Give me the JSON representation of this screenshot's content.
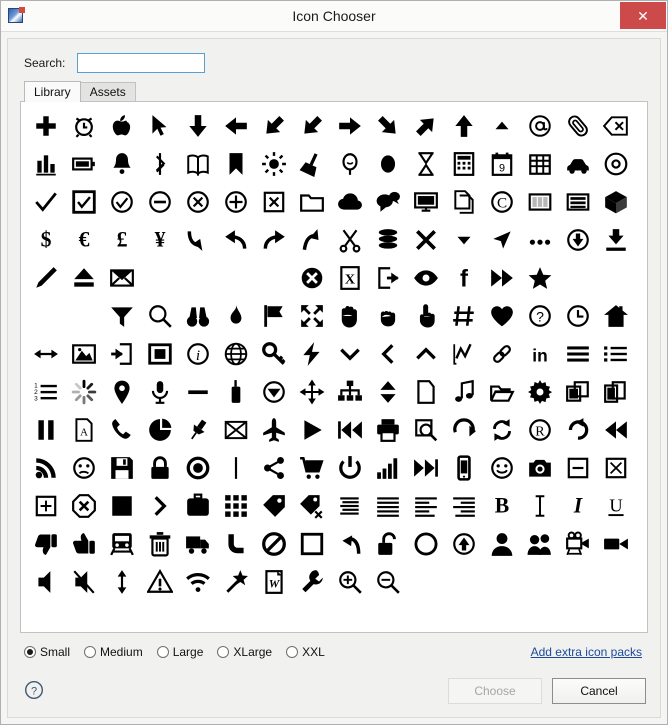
{
  "window": {
    "title": "Icon Chooser",
    "app_icon": "app-icon",
    "close_label": "✕"
  },
  "search": {
    "label": "Search:",
    "value": "",
    "placeholder": ""
  },
  "tabs": [
    {
      "label": "Library",
      "selected": true
    },
    {
      "label": "Assets",
      "selected": false
    }
  ],
  "sizes": {
    "options": [
      {
        "label": "Small",
        "checked": true
      },
      {
        "label": "Medium",
        "checked": false
      },
      {
        "label": "Large",
        "checked": false
      },
      {
        "label": "XLarge",
        "checked": false
      },
      {
        "label": "XXL",
        "checked": false
      }
    ]
  },
  "links": {
    "extra_packs": "Add extra icon packs"
  },
  "footer": {
    "help_icon": "question-mark-circle-icon",
    "choose_label": "Choose",
    "choose_enabled": false,
    "cancel_label": "Cancel",
    "cancel_enabled": true
  },
  "colors": {
    "close_button": "#cc4a4a",
    "link": "#1b4a9b",
    "search_border": "#5a9fd4",
    "window_bg": "#f1f1ef",
    "grid_bg": "#ffffff",
    "icon": "#000000"
  },
  "icon_grid": {
    "columns": 16,
    "rows": 13,
    "count": 202,
    "icons": [
      "plus-icon",
      "alarm-clock-icon",
      "apple-icon",
      "cursor-arrow-icon",
      "arrow-down-icon",
      "arrow-left-icon",
      "arrow-down-left-icon",
      "arrow-up-left-icon",
      "arrow-right-icon",
      "arrow-down-right-icon",
      "arrow-up-right-icon",
      "arrow-up-icon",
      "triangle-up-small-icon",
      "at-sign-icon",
      "paperclip-icon",
      "backspace-icon",
      "bar-chart-icon",
      "battery-icon",
      "bell-icon",
      "bluetooth-icon",
      "book-icon",
      "bookmark-icon",
      "brightness-icon",
      "broom-icon",
      "balloon-icon",
      "ellipse-icon",
      "hourglass-icon",
      "calculator-icon",
      "calendar-icon",
      "table-grid-icon",
      "car-icon",
      "disc-icon",
      "check-icon",
      "check-box-icon",
      "check-circle-icon",
      "minus-circle-icon",
      "x-circle-icon",
      "plus-circle-icon",
      "x-box-icon",
      "folder-icon",
      "cloud-icon",
      "chat-bubbles-icon",
      "monitor-icon",
      "copy-icon",
      "copyright-icon",
      "columns-icon",
      "rows-icon",
      "cube-icon",
      "dollar-icon",
      "euro-icon",
      "pound-icon",
      "yen-icon",
      "arrow-curve-down-icon",
      "arrow-undo-icon",
      "arrow-redo-icon",
      "arrow-curve-up-icon",
      "scissors-icon",
      "database-icon",
      "x-mark-icon",
      "triangle-down-small-icon",
      "navigation-icon",
      "ellipsis-icon",
      "download-circle-icon",
      "download-icon",
      "pencil-icon",
      "eject-icon",
      "envelope-icon",
      "triangle-down-outline-icon",
      "triangle-left-outline-icon",
      "triangle-right-outline-icon",
      "triangle-up-outline-icon",
      "x-circle-filled-icon",
      "excel-file-icon",
      "export-icon",
      "eye-icon",
      "facebook-icon",
      "fast-forward-icon",
      "star-icon",
      "triangle-down-filled-icon",
      "triangle-left-filled-icon",
      "triangle-right-filled-icon",
      "triangle-up-filled-icon",
      "filter-icon",
      "magnifier-icon",
      "binoculars-icon",
      "flame-icon",
      "flag-icon",
      "expand-icon",
      "hand-open-icon",
      "hand-grab-icon",
      "hand-pointing-icon",
      "hash-icon",
      "heart-icon",
      "question-circle-icon",
      "clock-icon",
      "home-icon",
      "horizontal-arrows-icon",
      "image-icon",
      "import-icon",
      "inner-box-icon",
      "info-circle-icon",
      "globe-icon",
      "key-icon",
      "lightning-icon",
      "chevron-down-icon",
      "chevron-left-icon",
      "chevron-up-icon",
      "line-chart-icon",
      "link-icon",
      "linkedin-icon",
      "menu-lines-icon",
      "list-bullets-icon",
      "numbered-list-icon",
      "loading-spinner-icon",
      "map-pin-icon",
      "microphone-icon",
      "minus-icon",
      "walkie-talkie-icon",
      "down-circle-icon",
      "move-icon",
      "network-icon",
      "sort-updown-icon",
      "file-icon",
      "music-note-icon",
      "folder-open-icon",
      "gear-icon",
      "copy-windows-icon",
      "copy-pages-icon",
      "pause-icon",
      "pdf-file-icon",
      "phone-icon",
      "pie-chart-icon",
      "pushpin-icon",
      "placeholder-box-icon",
      "airplane-icon",
      "play-icon",
      "rewind-start-icon",
      "printer-icon",
      "print-preview-icon",
      "rotate-right-icon",
      "refresh-icon",
      "registered-icon",
      "redo-circular-icon",
      "rewind-icon",
      "rss-icon",
      "sad-face-icon",
      "save-floppy-icon",
      "lock-icon",
      "record-icon",
      "separator-bar-icon",
      "share-icon",
      "shopping-cart-icon",
      "power-icon",
      "signal-bars-icon",
      "skip-forward-icon",
      "smartphone-icon",
      "smiley-icon",
      "camera-icon",
      "minus-box-icon",
      "x-box-outline-icon",
      "plus-box-icon",
      "stop-octagon-icon",
      "square-filled-icon",
      "chevron-right-icon",
      "briefcase-icon",
      "grid-apps-icon",
      "tag-icon",
      "tag-remove-icon",
      "align-center-icon",
      "align-justify-icon",
      "align-left-icon",
      "align-right-icon",
      "bold-icon",
      "text-cursor-icon",
      "italic-icon",
      "underline-icon",
      "thumbs-down-icon",
      "thumbs-up-icon",
      "train-icon",
      "trash-icon",
      "truck-icon",
      "twitter-icon",
      "no-entry-icon",
      "square-outline-icon",
      "undo-icon",
      "unlock-icon",
      "circle-outline-icon",
      "upload-circle-icon",
      "user-icon",
      "users-icon",
      "video-camera-old-icon",
      "video-camera-icon",
      "volume-icon",
      "volume-mute-icon",
      "vertical-arrows-icon",
      "warning-triangle-icon",
      "wifi-icon",
      "magic-wand-icon",
      "word-file-icon",
      "wrench-icon",
      "zoom-in-icon",
      "zoom-out-icon"
    ]
  }
}
